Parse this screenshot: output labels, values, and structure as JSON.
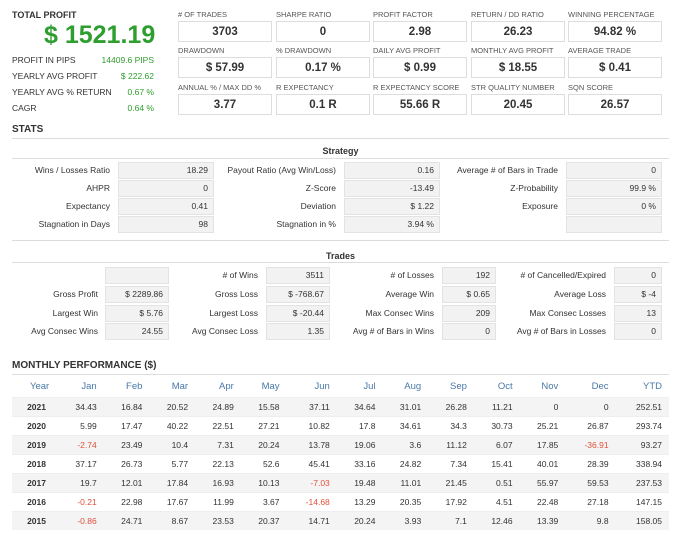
{
  "summary": {
    "total_profit_label": "TOTAL PROFIT",
    "total_profit_value": "$ 1521.19",
    "rows": [
      {
        "label": "PROFIT IN PIPS",
        "value": "14409.6 PIPS"
      },
      {
        "label": "YEARLY AVG PROFIT",
        "value": "$ 222.62"
      },
      {
        "label": "YEARLY AVG % RETURN",
        "value": "0.67 %"
      },
      {
        "label": "CAGR",
        "value": "0.64 %"
      }
    ]
  },
  "metrics": [
    {
      "label": "# OF TRADES",
      "value": "3703"
    },
    {
      "label": "SHARPE RATIO",
      "value": "0"
    },
    {
      "label": "PROFIT FACTOR",
      "value": "2.98"
    },
    {
      "label": "RETURN / DD RATIO",
      "value": "26.23"
    },
    {
      "label": "WINNING PERCENTAGE",
      "value": "94.82 %"
    },
    {
      "label": "DRAWDOWN",
      "value": "$ 57.99"
    },
    {
      "label": "% DRAWDOWN",
      "value": "0.17 %"
    },
    {
      "label": "DAILY AVG PROFIT",
      "value": "$ 0.99"
    },
    {
      "label": "MONTHLY AVG PROFIT",
      "value": "$ 18.55"
    },
    {
      "label": "AVERAGE TRADE",
      "value": "$ 0.41"
    },
    {
      "label": "ANNUAL % / MAX DD %",
      "value": "3.77"
    },
    {
      "label": "R EXPECTANCY",
      "value": "0.1 R"
    },
    {
      "label": "R EXPECTANCY SCORE",
      "value": "55.66 R"
    },
    {
      "label": "STR QUALITY NUMBER",
      "value": "20.45"
    },
    {
      "label": "SQN SCORE",
      "value": "26.57"
    }
  ],
  "stats": {
    "title": "STATS",
    "strategy_title": "Strategy",
    "strategy": [
      {
        "label": "Wins / Losses Ratio",
        "value": "18.29"
      },
      {
        "label": "Payout Ratio (Avg Win/Loss)",
        "value": "0.16"
      },
      {
        "label": "Average # of Bars in Trade",
        "value": "0"
      },
      {
        "label": "AHPR",
        "value": "0"
      },
      {
        "label": "Z-Score",
        "value": "-13.49"
      },
      {
        "label": "Z-Probability",
        "value": "99.9 %"
      },
      {
        "label": "Expectancy",
        "value": "0.41"
      },
      {
        "label": "Deviation",
        "value": "$ 1.22"
      },
      {
        "label": "Exposure",
        "value": "0 %"
      },
      {
        "label": "Stagnation in Days",
        "value": "98"
      },
      {
        "label": "Stagnation in %",
        "value": "3.94 %"
      },
      {
        "label": "",
        "value": ""
      }
    ],
    "trades_title": "Trades",
    "trades": [
      {
        "label": "",
        "value": ""
      },
      {
        "label": "# of Wins",
        "value": "3511"
      },
      {
        "label": "# of Losses",
        "value": "192"
      },
      {
        "label": "# of Cancelled/Expired",
        "value": "0"
      },
      {
        "label": "Gross Profit",
        "value": "$ 2289.86"
      },
      {
        "label": "Gross Loss",
        "value": "$ -768.67"
      },
      {
        "label": "Average Win",
        "value": "$ 0.65"
      },
      {
        "label": "Average Loss",
        "value": "$ -4"
      },
      {
        "label": "Largest Win",
        "value": "$ 5.76"
      },
      {
        "label": "Largest Loss",
        "value": "$ -20.44"
      },
      {
        "label": "Max Consec Wins",
        "value": "209"
      },
      {
        "label": "Max Consec Losses",
        "value": "13"
      },
      {
        "label": "Avg Consec Wins",
        "value": "24.55"
      },
      {
        "label": "Avg Consec Loss",
        "value": "1.35"
      },
      {
        "label": "Avg # of Bars in Wins",
        "value": "0"
      },
      {
        "label": "Avg # of Bars in Losses",
        "value": "0"
      }
    ]
  },
  "monthly": {
    "title": "MONTHLY PERFORMANCE ($)",
    "headers": [
      "Year",
      "Jan",
      "Feb",
      "Mar",
      "Apr",
      "May",
      "Jun",
      "Jul",
      "Aug",
      "Sep",
      "Oct",
      "Nov",
      "Dec",
      "YTD"
    ],
    "rows": [
      [
        "2021",
        "34.43",
        "16.84",
        "20.52",
        "24.89",
        "15.58",
        "37.11",
        "34.64",
        "31.01",
        "26.28",
        "11.21",
        "0",
        "0",
        "252.51"
      ],
      [
        "2020",
        "5.99",
        "17.47",
        "40.22",
        "22.51",
        "27.21",
        "10.82",
        "17.8",
        "34.61",
        "34.3",
        "30.73",
        "25.21",
        "26.87",
        "293.74"
      ],
      [
        "2019",
        "-2.74",
        "23.49",
        "10.4",
        "7.31",
        "20.24",
        "13.78",
        "19.06",
        "3.6",
        "11.12",
        "6.07",
        "17.85",
        "-36.91",
        "93.27"
      ],
      [
        "2018",
        "37.17",
        "26.73",
        "5.77",
        "22.13",
        "52.6",
        "45.41",
        "33.16",
        "24.82",
        "7.34",
        "15.41",
        "40.01",
        "28.39",
        "338.94"
      ],
      [
        "2017",
        "19.7",
        "12.01",
        "17.84",
        "16.93",
        "10.13",
        "-7.03",
        "19.48",
        "11.01",
        "21.45",
        "0.51",
        "55.97",
        "59.53",
        "237.53"
      ],
      [
        "2016",
        "-0.21",
        "22.98",
        "17.67",
        "11.99",
        "3.67",
        "-14.68",
        "13.29",
        "20.35",
        "17.92",
        "4.51",
        "22.48",
        "27.18",
        "147.15"
      ],
      [
        "2015",
        "-0.86",
        "24.71",
        "8.67",
        "23.53",
        "20.37",
        "14.71",
        "20.24",
        "3.93",
        "7.1",
        "12.46",
        "13.39",
        "9.8",
        "158.05"
      ]
    ]
  },
  "colors": {
    "profit_green": "#2e9e2e",
    "negative_red": "#e0513a",
    "header_blue": "#4a78a8"
  }
}
